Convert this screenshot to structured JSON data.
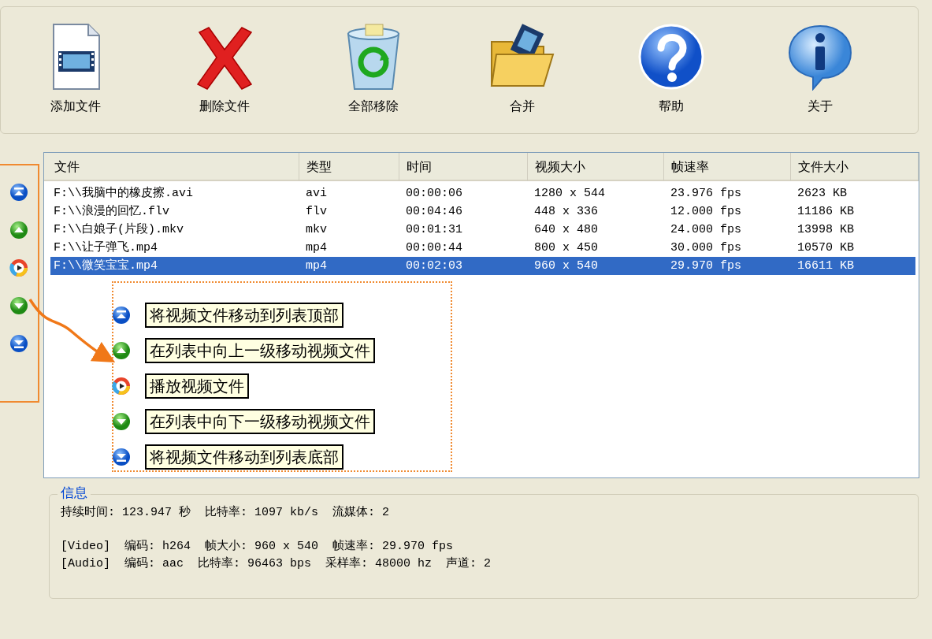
{
  "toolbar": [
    {
      "kind": "add",
      "label": "添加文件"
    },
    {
      "kind": "delete",
      "label": "删除文件"
    },
    {
      "kind": "clear",
      "label": "全部移除"
    },
    {
      "kind": "merge",
      "label": "合并"
    },
    {
      "kind": "help",
      "label": "帮助"
    },
    {
      "kind": "about",
      "label": "关于"
    }
  ],
  "side_buttons": [
    {
      "kind": "top"
    },
    {
      "kind": "up"
    },
    {
      "kind": "play"
    },
    {
      "kind": "down"
    },
    {
      "kind": "bottom"
    }
  ],
  "table": {
    "columns": [
      "文件",
      "类型",
      "时间",
      "视频大小",
      "帧速率",
      "文件大小"
    ],
    "rows": [
      {
        "selected": false,
        "cells": [
          "F:\\\\我脑中的橡皮擦.avi",
          "avi",
          "00:00:06",
          "1280 x 544",
          "23.976 fps",
          "2623 KB"
        ]
      },
      {
        "selected": false,
        "cells": [
          "F:\\\\浪漫的回忆.flv",
          "flv",
          "00:04:46",
          "448 x 336",
          "12.000 fps",
          "11186 KB"
        ]
      },
      {
        "selected": false,
        "cells": [
          "F:\\\\白娘子(片段).mkv",
          "mkv",
          "00:01:31",
          "640 x 480",
          "24.000 fps",
          "13998 KB"
        ]
      },
      {
        "selected": false,
        "cells": [
          "F:\\\\让子弹飞.mp4",
          "mp4",
          "00:00:44",
          "800 x 450",
          "30.000 fps",
          "10570 KB"
        ]
      },
      {
        "selected": true,
        "cells": [
          "F:\\\\微笑宝宝.mp4",
          "mp4",
          "00:02:03",
          "960 x 540",
          "29.970 fps",
          "16611 KB"
        ]
      }
    ]
  },
  "legend": [
    {
      "kind": "top",
      "text": "将视频文件移动到列表顶部"
    },
    {
      "kind": "up",
      "text": "在列表中向上一级移动视频文件"
    },
    {
      "kind": "play",
      "text": "播放视频文件"
    },
    {
      "kind": "down",
      "text": "在列表中向下一级移动视频文件"
    },
    {
      "kind": "bottom",
      "text": "将视频文件移动到列表底部"
    }
  ],
  "info": {
    "title": "信息",
    "summary": "持续时间: 123.947 秒  比特率: 1097 kb/s  流媒体: 2",
    "video": "[Video]  编码: h264  帧大小: 960 x 540  帧速率: 29.970 fps",
    "audio": "[Audio]  编码: aac  比特率: 96463 bps  采样率: 48000 hz  声道: 2"
  }
}
